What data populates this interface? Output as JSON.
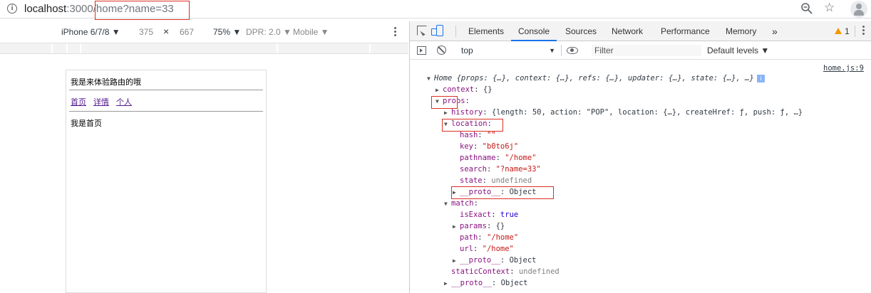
{
  "address_bar": {
    "host": "localhost",
    "port": ":3000",
    "slash": "/",
    "path": "home?name=33"
  },
  "device_toolbar": {
    "device": "iPhone 6/7/8 ▼",
    "width": "375",
    "times": "×",
    "height": "667",
    "zoom": "75% ▼",
    "dpr": "DPR: 2.0 ▼",
    "mode": "Mobile ▼"
  },
  "app": {
    "title": "我是来体验路由的哦",
    "nav": [
      "首页",
      "详情",
      "个人"
    ],
    "content": "我是首页"
  },
  "devtools": {
    "tabs": [
      "Elements",
      "Console",
      "Sources",
      "Network",
      "Performance",
      "Memory"
    ],
    "more": "»",
    "warning_count": "1",
    "context": "top",
    "context_arrow": "▼",
    "filter_placeholder": "Filter",
    "levels": "Default levels ▼",
    "source_link": "home.js:9"
  },
  "console_lines": [
    {
      "indent": 0,
      "tri": "▼",
      "text": "Home {props: {…}, context: {…}, refs: {…}, updater: {…}, state: {…}, …}"
    },
    {
      "indent": 1,
      "tri": "▶",
      "key": "context",
      "val": "{}"
    },
    {
      "indent": 1,
      "tri": "▼",
      "key": "props",
      "val": ""
    },
    {
      "indent": 2,
      "tri": "▶",
      "key": "history",
      "val": "{length: 50, action: \"POP\", location: {…}, createHref: ƒ, push: ƒ, …}"
    },
    {
      "indent": 2,
      "tri": "▼",
      "key": "location",
      "val": ""
    },
    {
      "indent": 3,
      "tri": "",
      "key": "hash",
      "val": "\"\""
    },
    {
      "indent": 3,
      "tri": "",
      "key": "key",
      "val": "\"b0to6j\""
    },
    {
      "indent": 3,
      "tri": "",
      "key": "pathname",
      "val": "\"/home\""
    },
    {
      "indent": 3,
      "tri": "",
      "key": "search",
      "val": "\"?name=33\""
    },
    {
      "indent": 3,
      "tri": "",
      "key": "state",
      "val": "undefined"
    },
    {
      "indent": 3,
      "tri": "▶",
      "key": "__proto__",
      "val": "Object"
    },
    {
      "indent": 2,
      "tri": "▼",
      "key": "match",
      "val": ""
    },
    {
      "indent": 3,
      "tri": "",
      "key": "isExact",
      "val": "true"
    },
    {
      "indent": 3,
      "tri": "▶",
      "key": "params",
      "val": "{}"
    },
    {
      "indent": 3,
      "tri": "",
      "key": "path",
      "val": "\"/home\""
    },
    {
      "indent": 3,
      "tri": "",
      "key": "url",
      "val": "\"/home\""
    },
    {
      "indent": 3,
      "tri": "▶",
      "key": "__proto__",
      "val": "Object"
    },
    {
      "indent": 2,
      "tri": "",
      "key": "staticContext",
      "val": "undefined"
    },
    {
      "indent": 2,
      "tri": "▶",
      "key": "__proto__",
      "val": "Object"
    }
  ],
  "colors": {
    "highlight": "#d93025",
    "accent": "#1a73e8",
    "link": "#551a8b"
  }
}
